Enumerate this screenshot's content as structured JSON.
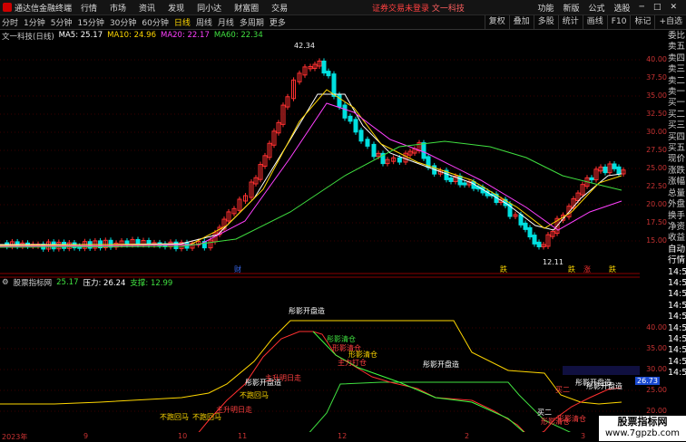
{
  "titlebar": {
    "app_title": "通达信金融终端",
    "menu": [
      "行情",
      "市场",
      "资讯",
      "发现",
      "同小达",
      "财富圈",
      "交易"
    ],
    "notice": "证券交易未登录",
    "stock": "文一科技",
    "right": [
      "功能",
      "新版",
      "公式",
      "选股"
    ]
  },
  "periods": [
    "分时",
    "1分钟",
    "5分钟",
    "15分钟",
    "30分钟",
    "60分钟",
    "日线",
    "周线",
    "月线",
    "多周期",
    "更多"
  ],
  "active_period": "日线",
  "right_tabs": [
    "复权",
    "叠加",
    "多股",
    "统计",
    "画线",
    "F10",
    "标记",
    "+自选"
  ],
  "price_legend": {
    "name": "文一科技(日线)",
    "ma5": "MA5: 25.17",
    "ma10": "MA10: 24.96",
    "ma20": "MA20: 22.17",
    "ma60": "MA60: 22.34",
    "colors": {
      "ma5": "#ffffff",
      "ma10": "#ffd700",
      "ma20": "#ff40ff",
      "ma60": "#40e040"
    }
  },
  "price_axis": [
    "40.00",
    "37.50",
    "35.00",
    "32.50",
    "30.00",
    "27.50",
    "25.00",
    "22.50",
    "20.00",
    "17.50",
    "15.00"
  ],
  "indicator_legend": {
    "name": "股票指标网",
    "v1": "25.17",
    "v2": "压力: 26.24",
    "v3": "支撑: 12.99"
  },
  "indicator_axis": [
    "40.00",
    "35.00",
    "30.00",
    "25.00",
    "20.00"
  ],
  "current_value": "26.73",
  "high_label": "42.34",
  "low_label": "12.11",
  "side_panel": [
    "委比",
    "卖五",
    "卖四",
    "卖三",
    "卖二",
    "卖一",
    "买一",
    "买二",
    "买三",
    "买四",
    "买五",
    "现价",
    "涨跌",
    "涨幅",
    "总量",
    "外盘",
    "换手",
    "净资",
    "收益",
    "自动",
    "行情",
    "14:5",
    "14:5",
    "14:5",
    "14:5",
    "14:5",
    "14:5",
    "14:5",
    "14:5",
    "14:5",
    "14:5"
  ],
  "dates": [
    "2023年",
    "9",
    "10",
    "11",
    "12",
    "2",
    "3"
  ],
  "events": [
    {
      "t": "财",
      "c": "#3a6af0"
    },
    {
      "t": "跌",
      "c": "#ffd700"
    },
    {
      "t": "跌",
      "c": "#ffd700"
    },
    {
      "t": "涨",
      "c": "#ff3030"
    },
    {
      "t": "跌",
      "c": "#ffd700"
    }
  ],
  "annotations": [
    "彤影开盘造",
    "彤影清仓",
    "彤影开盘造",
    "彤影开盘造",
    "彤影开盘造",
    "彤影开盘造",
    "主升明日走",
    "主升明日走",
    "不跑回马",
    "不跑回马",
    "不跑回马",
    "主力打仓",
    "形影清仓",
    "形影清仓",
    "形影清仓",
    "形影清仓",
    "买二",
    "买二"
  ],
  "watermark": {
    "line1": "股票指标网",
    "line2": "www.7gpzb.com"
  }
}
